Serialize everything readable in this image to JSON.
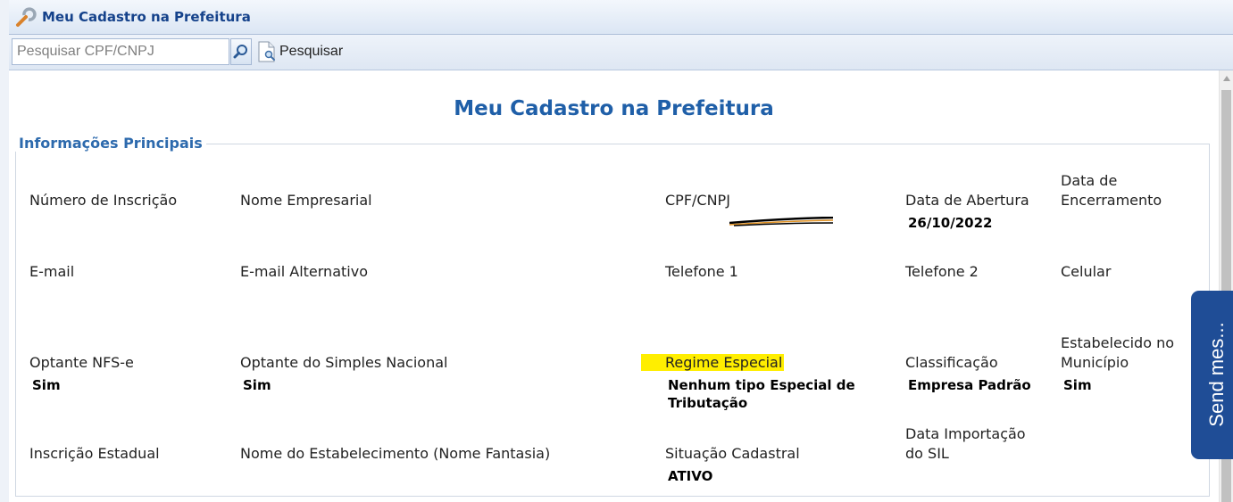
{
  "window": {
    "title": "Meu Cadastro na Prefeitura"
  },
  "toolbar": {
    "search_placeholder": "Pesquisar CPF/CNPJ",
    "search_value": "",
    "pesquisar_label": "Pesquisar"
  },
  "page": {
    "heading": "Meu Cadastro na Prefeitura"
  },
  "section": {
    "legend": "Informações Principais"
  },
  "fields": {
    "numero_inscricao": {
      "label": "Número de Inscrição",
      "value": ""
    },
    "nome_empresarial": {
      "label": "Nome Empresarial",
      "value": ""
    },
    "cpf_cnpj": {
      "label": "CPF/CNPJ",
      "value": ""
    },
    "data_abertura": {
      "label": "Data de Abertura",
      "value": "26/10/2022"
    },
    "data_encerramento": {
      "label_line1": "Data de",
      "label_line2": "Encerramento",
      "value": ""
    },
    "email": {
      "label": "E-mail",
      "value": ""
    },
    "email_alternativo": {
      "label": "E-mail Alternativo",
      "value": ""
    },
    "telefone1": {
      "label": "Telefone 1",
      "value": ""
    },
    "telefone2": {
      "label": "Telefone 2",
      "value": ""
    },
    "celular": {
      "label": "Celular",
      "value": ""
    },
    "optante_nfse": {
      "label": "Optante NFS-e",
      "value": "Sim"
    },
    "optante_simples": {
      "label": "Optante do Simples Nacional",
      "value": "Sim"
    },
    "regime_especial": {
      "label": "Regime Especial",
      "value_line1": "Nenhum tipo Especial de",
      "value_line2": "Tributação"
    },
    "classificacao": {
      "label": "Classificação",
      "value": "Empresa Padrão"
    },
    "estabelecido_municipio": {
      "label_line1": "Estabelecido no",
      "label_line2": "Município",
      "value": "Sim"
    },
    "inscricao_estadual": {
      "label": "Inscrição Estadual",
      "value": ""
    },
    "nome_estabelecimento": {
      "label": "Nome do Estabelecimento (Nome Fantasia)",
      "value": ""
    },
    "situacao_cadastral": {
      "label": "Situação Cadastral",
      "value": "ATIVO"
    },
    "data_importacao_sil": {
      "label_line1": "Data Importação",
      "label_line2": "do SIL",
      "value": ""
    }
  },
  "feedback": {
    "label": "Send mes..."
  },
  "colors": {
    "accent": "#1f5fa8",
    "highlight": "#ffee00",
    "feedback_tab": "#1f4d96"
  }
}
